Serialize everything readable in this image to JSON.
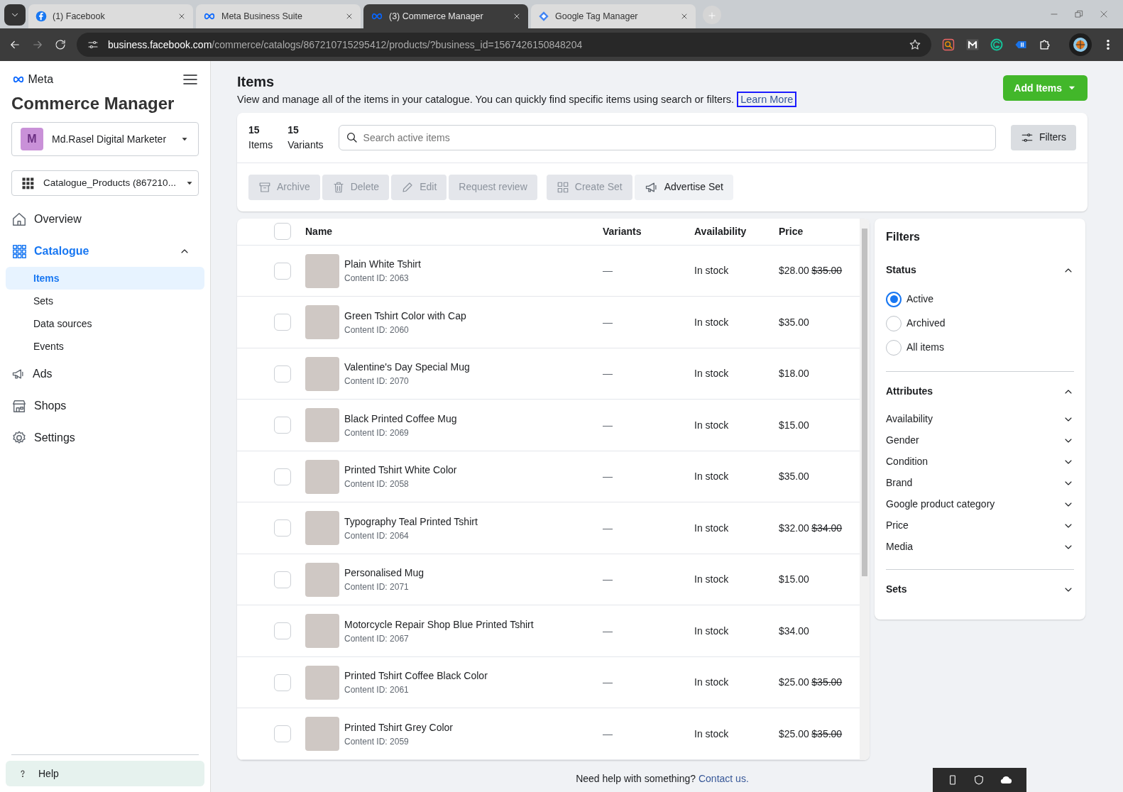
{
  "browser": {
    "tabs": [
      {
        "title": "(1) Facebook",
        "kind": "facebook",
        "selected": false
      },
      {
        "title": "Meta Business Suite",
        "kind": "meta",
        "selected": false
      },
      {
        "title": "(3) Commerce Manager",
        "kind": "meta",
        "selected": true
      },
      {
        "title": "Google Tag Manager",
        "kind": "gtm",
        "selected": false
      }
    ],
    "url_host": "business.facebook.com",
    "url_path": "/commerce/catalogs/867210715295412/products/?business_id=1567426150848204"
  },
  "sidebar": {
    "brand": "Meta",
    "title": "Commerce Manager",
    "account": {
      "initial": "M",
      "name": "Md.Rasel Digital Marketer"
    },
    "catalogue_picker": "Catalogue_Products (867210...",
    "items": [
      {
        "label": "Overview",
        "kind": "home",
        "selected": false
      },
      {
        "label": "Catalogue",
        "kind": "grid",
        "selected": true,
        "expanded": true,
        "children": [
          {
            "label": "Items",
            "selected": true
          },
          {
            "label": "Sets",
            "selected": false
          },
          {
            "label": "Data sources",
            "selected": false
          },
          {
            "label": "Events",
            "selected": false
          }
        ]
      },
      {
        "label": "Ads",
        "kind": "megaphone",
        "selected": false
      },
      {
        "label": "Shops",
        "kind": "shop",
        "selected": false
      },
      {
        "label": "Settings",
        "kind": "gear",
        "selected": false
      }
    ],
    "help": "Help"
  },
  "header": {
    "title": "Items",
    "description": "View and manage all of the items in your catalogue. You can quickly find specific items using search or filters.",
    "learn_more": "Learn More",
    "add_button": "Add Items"
  },
  "summary": [
    {
      "count": "15",
      "label": "Items"
    },
    {
      "count": "15",
      "label": "Variants"
    }
  ],
  "search": {
    "placeholder": "Search active items"
  },
  "filters_button": "Filters",
  "actions": [
    {
      "label": "Archive",
      "kind": "archive",
      "disabled": true
    },
    {
      "label": "Delete",
      "kind": "trash",
      "disabled": true
    },
    {
      "label": "Edit",
      "kind": "pencil",
      "disabled": true
    },
    {
      "label": "Request review",
      "disabled": true
    },
    {
      "label": "Create Set",
      "kind": "grid",
      "disabled": true
    },
    {
      "label": "Advertise Set",
      "kind": "megaphone",
      "disabled": false
    }
  ],
  "table": {
    "select_all_checked": false,
    "columns": [
      "Name",
      "Variants",
      "Availability",
      "Price"
    ],
    "rows": [
      {
        "name": "Plain White Tshirt",
        "content_id": "Content ID: 2063",
        "variants": "—",
        "availability": "In stock",
        "price": "$28.00",
        "old_price": "$35.00",
        "checked": false
      },
      {
        "name": "Green Tshirt Color with Cap",
        "content_id": "Content ID: 2060",
        "variants": "—",
        "availability": "In stock",
        "price": "$35.00",
        "checked": false
      },
      {
        "name": "Valentine's Day Special Mug",
        "content_id": "Content ID: 2070",
        "variants": "—",
        "availability": "In stock",
        "price": "$18.00",
        "checked": false
      },
      {
        "name": "Black Printed Coffee Mug",
        "content_id": "Content ID: 2069",
        "variants": "—",
        "availability": "In stock",
        "price": "$15.00",
        "checked": false
      },
      {
        "name": "Printed Tshirt White Color",
        "content_id": "Content ID: 2058",
        "variants": "—",
        "availability": "In stock",
        "price": "$35.00",
        "checked": false
      },
      {
        "name": "Typography Teal Printed Tshirt",
        "content_id": "Content ID: 2064",
        "variants": "—",
        "availability": "In stock",
        "price": "$32.00",
        "old_price": "$34.00",
        "checked": false
      },
      {
        "name": "Personalised Mug",
        "content_id": "Content ID: 2071",
        "variants": "—",
        "availability": "In stock",
        "price": "$15.00",
        "checked": false
      },
      {
        "name": "Motorcycle Repair Shop Blue Printed Tshirt",
        "content_id": "Content ID: 2067",
        "variants": "—",
        "availability": "In stock",
        "price": "$34.00",
        "checked": false
      },
      {
        "name": "Printed Tshirt Coffee Black Color",
        "content_id": "Content ID: 2061",
        "variants": "—",
        "availability": "In stock",
        "price": "$25.00",
        "old_price": "$35.00",
        "checked": false
      },
      {
        "name": "Printed Tshirt Grey Color",
        "content_id": "Content ID: 2059",
        "variants": "—",
        "availability": "In stock",
        "price": "$25.00",
        "old_price": "$35.00",
        "checked": false
      }
    ]
  },
  "filters": {
    "title": "Filters",
    "sections": [
      {
        "title": "Status",
        "expanded": true,
        "kind": "radio",
        "options": [
          {
            "label": "Active",
            "selected": true
          },
          {
            "label": "Archived",
            "selected": false
          },
          {
            "label": "All items",
            "selected": false
          }
        ]
      },
      {
        "title": "Attributes",
        "expanded": true,
        "kind": "dropdowns",
        "options": [
          {
            "label": "Availability"
          },
          {
            "label": "Gender"
          },
          {
            "label": "Condition"
          },
          {
            "label": "Brand"
          },
          {
            "label": "Google product category"
          },
          {
            "label": "Price"
          },
          {
            "label": "Media"
          }
        ]
      },
      {
        "title": "Sets",
        "expanded": false
      }
    ]
  },
  "footer": {
    "text": "Need help with something?",
    "link": "Contact us."
  }
}
